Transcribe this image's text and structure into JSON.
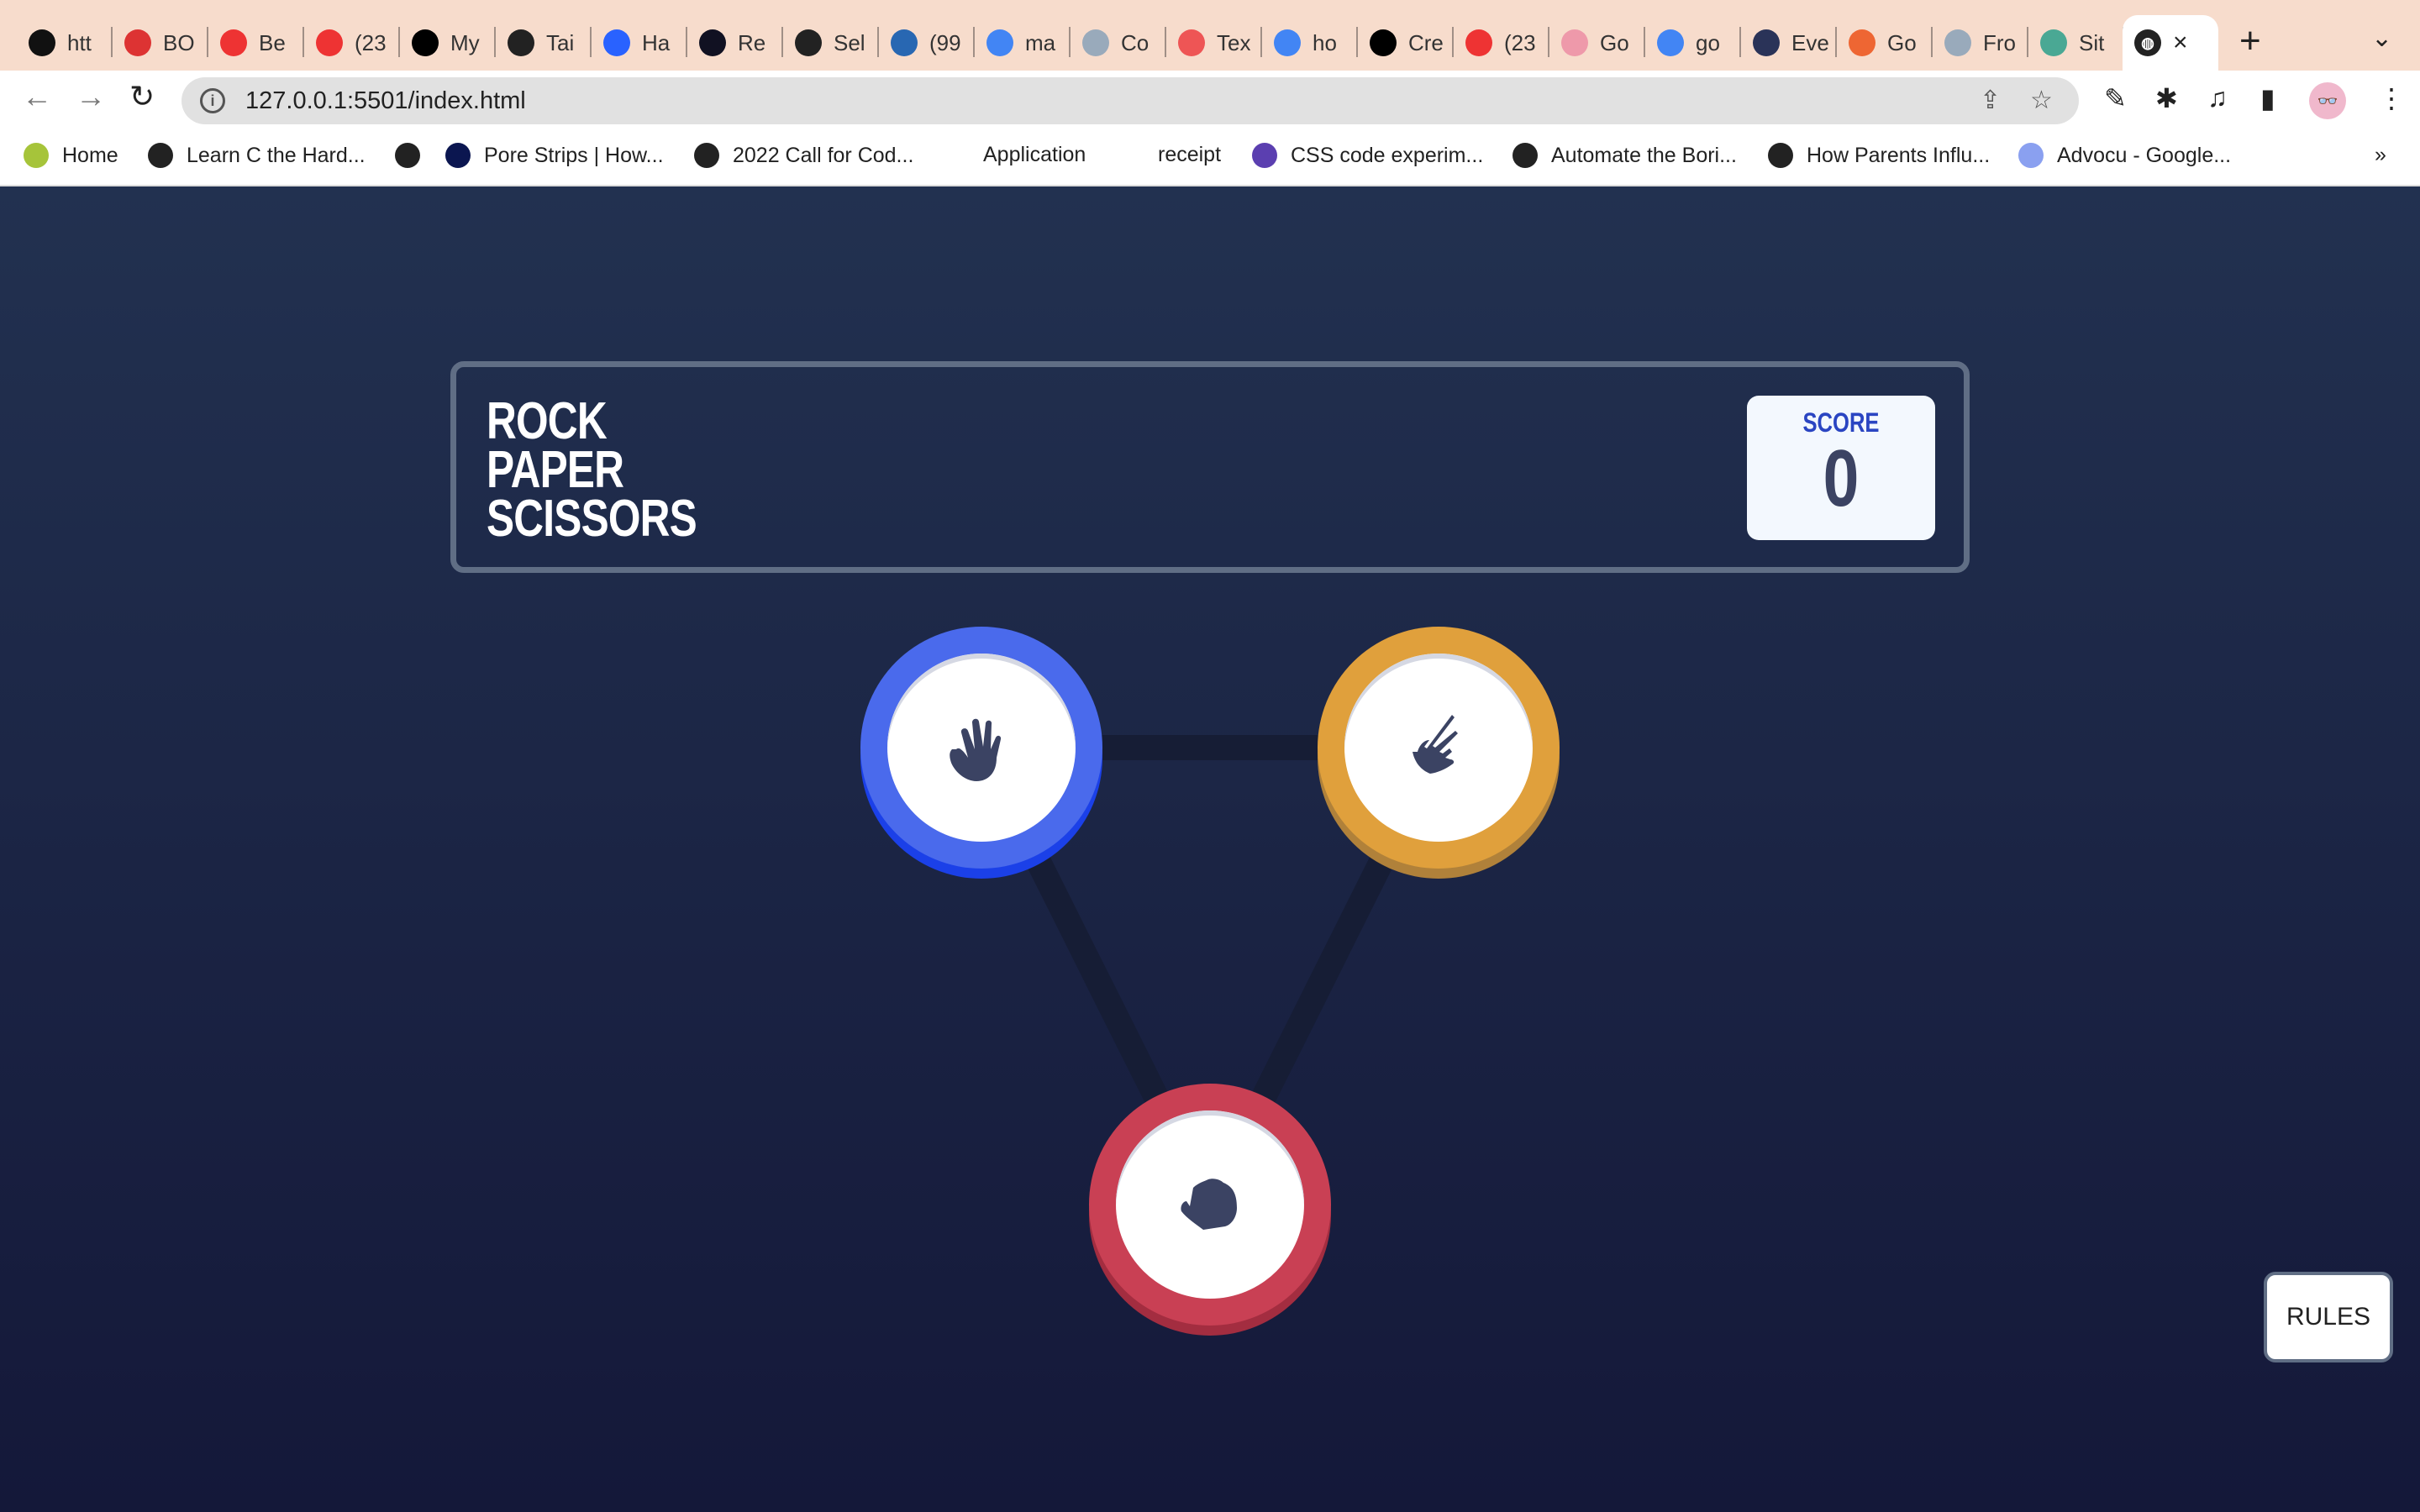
{
  "browser": {
    "tabs": [
      {
        "label": "htt",
        "color": "#111"
      },
      {
        "label": "BO",
        "color": "#d33"
      },
      {
        "label": "Be",
        "color": "#e33"
      },
      {
        "label": "(23",
        "color": "#e33"
      },
      {
        "label": "My",
        "color": "#000"
      },
      {
        "label": "Tai",
        "color": "#222"
      },
      {
        "label": "Ha",
        "color": "#2962ff"
      },
      {
        "label": "Re",
        "color": "#112"
      },
      {
        "label": "Sel",
        "color": "#222"
      },
      {
        "label": "(99",
        "color": "#2867b2"
      },
      {
        "label": "ma",
        "color": "#4285f4"
      },
      {
        "label": "Co",
        "color": "#9ab"
      },
      {
        "label": "Tex",
        "color": "#e55"
      },
      {
        "label": "ho",
        "color": "#4285f4"
      },
      {
        "label": "Cre",
        "color": "#000"
      },
      {
        "label": "(23",
        "color": "#e33"
      },
      {
        "label": "Go",
        "color": "#e9a"
      },
      {
        "label": "go",
        "color": "#4285f4"
      },
      {
        "label": "Eve",
        "color": "#2a3358"
      },
      {
        "label": "Go",
        "color": "#e63"
      },
      {
        "label": "Fro",
        "color": "#9ab"
      },
      {
        "label": "Sit",
        "color": "#4aa894"
      }
    ],
    "active_tab_close": "×",
    "new_tab": "+",
    "url": "127.0.0.1:5501/index.html",
    "bookmarks": [
      "Home",
      "Learn C the Hard...",
      "",
      "Pore Strips | How...",
      "2022 Call for Cod...",
      "Application",
      "receipt",
      "CSS code experim...",
      "Automate the Bori...",
      "How Parents Influ...",
      "Advocu - Google..."
    ],
    "bookmarks_overflow": "»"
  },
  "game": {
    "title_lines": [
      "ROCK",
      "PAPER",
      "SCISSORS"
    ],
    "score_label": "SCORE",
    "score": "0",
    "rules_label": "RULES",
    "colors": {
      "paper": "#4a6aec",
      "scissors": "#e0a03c",
      "rock": "#c94054",
      "background": "#1c2645"
    }
  }
}
